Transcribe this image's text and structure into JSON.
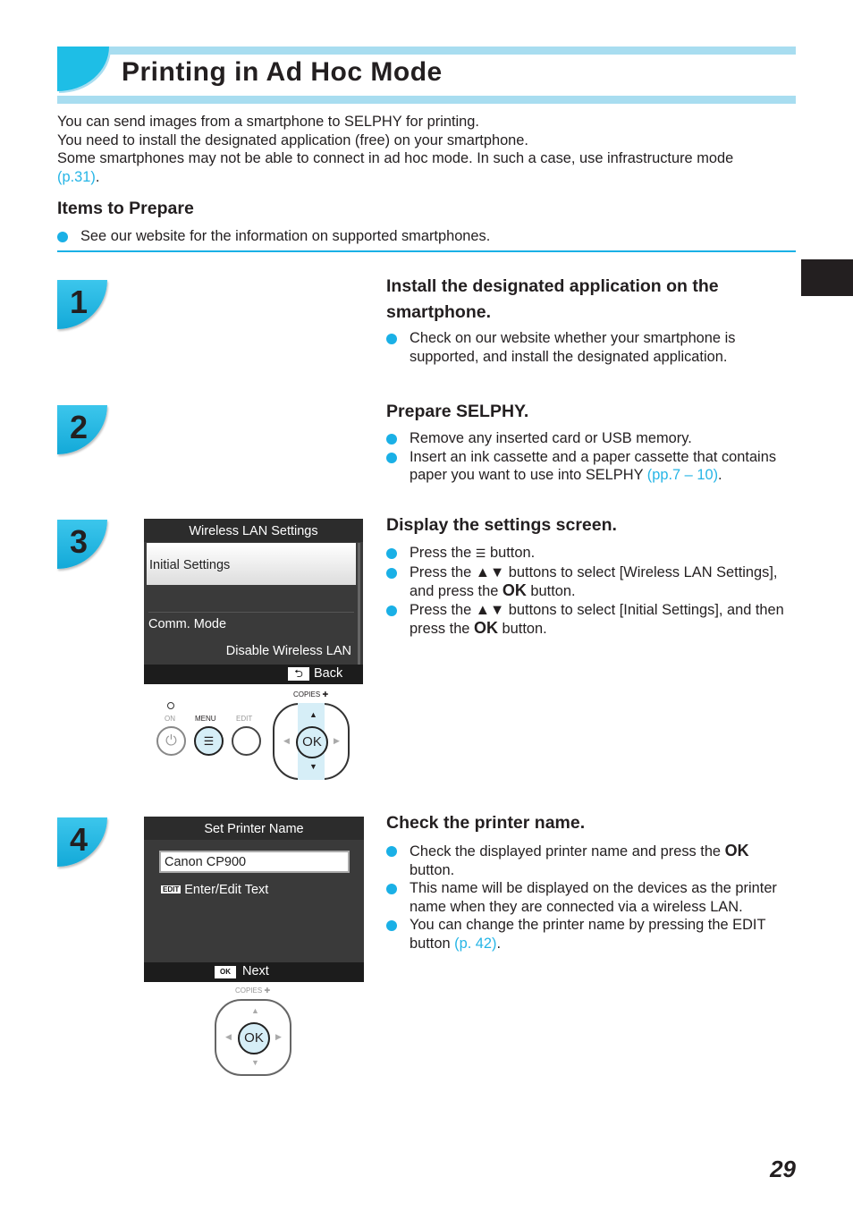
{
  "header": {
    "title": "Printing in Ad Hoc Mode"
  },
  "intro": {
    "lines": [
      "You can send images from a smartphone to SELPHY for printing.",
      "You need to install the designated application (free) on your smartphone.",
      "Some smartphones may not be able to connect in ad hoc mode. In such a case, use infrastructure mode"
    ],
    "link": "(p.31)",
    "link_tail": "."
  },
  "prepare": {
    "heading": "Items to Prepare",
    "items": [
      "See our website for the information on supported smartphones."
    ]
  },
  "steps": [
    {
      "number": "1",
      "heading_l1": "Install the designated application on the",
      "heading_l2": "smartphone.",
      "bullets": [
        "Check on our website whether your smartphone is supported, and install the designated application."
      ]
    },
    {
      "number": "2",
      "heading": "Prepare SELPHY.",
      "bullets": [
        "Remove any inserted card or USB memory."
      ],
      "bullet2": "Insert an ink cassette and a paper cassette that contains paper you want to use into SELPHY ",
      "bullet2_link": "(pp.7 – 10)",
      "bullet2_tail": "."
    },
    {
      "number": "3",
      "heading": "Display the settings screen.",
      "b1a": "Press the ",
      "b1b": " button.",
      "b2a": "Press the ",
      "arrows": "▲▼",
      "b2b": " buttons to select [Wireless LAN Settings], and press the ",
      "ok": "OK",
      "b2c": " button.",
      "b3b": " buttons to select [Initial Settings], and then press the ",
      "b3c": " button.",
      "screen": {
        "title": "Wireless LAN Settings",
        "selected": "Initial Settings",
        "item2": "Comm. Mode",
        "value2": "Disable Wireless LAN",
        "back": "Back"
      },
      "buttons": {
        "on": "ON",
        "menu": "MENU",
        "edit": "EDIT",
        "copies": "COPIES",
        "ok": "OK"
      }
    },
    {
      "number": "4",
      "heading": "Check the printer name.",
      "b1a": "Check the displayed printer name and press the ",
      "ok": "OK",
      "b1b": " button.",
      "b2": "This name will be displayed on the devices as the printer name when they are connected via a wireless LAN.",
      "b3": "You can change the printer name by pressing the EDIT button ",
      "b3_link": "(p. 42)",
      "b3_tail": ".",
      "screen": {
        "title": "Set Printer Name",
        "name_value": "Canon CP900",
        "edit_tag": "EDIT",
        "edit_label": "Enter/Edit Text",
        "ok_tag": "OK",
        "next": "Next"
      },
      "buttons": {
        "copies": "COPIES",
        "ok": "OK"
      }
    }
  ],
  "page_number": "29",
  "colors": {
    "accent": "#1ab0e6",
    "title_band": "#a8ddf0",
    "link": "#26b5e6",
    "button_fill": "#d6eef7"
  }
}
